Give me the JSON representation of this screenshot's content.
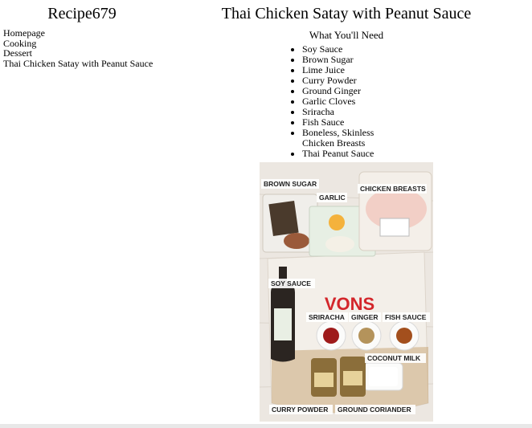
{
  "site": {
    "title": "Recipe679"
  },
  "nav": {
    "items": [
      {
        "label": "Homepage"
      },
      {
        "label": "Cooking"
      },
      {
        "label": "Dessert"
      },
      {
        "label": "Thai Chicken Satay with Peanut Sauce"
      }
    ]
  },
  "recipe": {
    "title": "Thai Chicken Satay with Peanut Sauce",
    "needs_heading": "What You'll Need",
    "ingredients": [
      "Soy Sauce",
      "Brown Sugar",
      "Lime Juice",
      "Curry Powder",
      "Ground Ginger",
      "Garlic Cloves",
      "Sriracha",
      "Fish Sauce",
      "Boneless, Skinless Chicken Breasts",
      "Thai Peanut Sauce"
    ]
  },
  "photo": {
    "labels": {
      "brown_sugar": "BROWN SUGAR",
      "garlic": "GARLIC",
      "chicken_breasts": "CHICKEN BREASTS",
      "soy_sauce": "SOY SAUCE",
      "sriracha": "SRIRACHA",
      "ginger": "GINGER",
      "fish_sauce": "FISH SAUCE",
      "coconut_milk": "COCONUT MILK",
      "curry_powder": "CURRY POWDER",
      "ground_coriander": "GROUND CORIANDER"
    },
    "bag_brand": "VONS",
    "colors": {
      "background": "#ece7e1",
      "bag": "#f3efe9",
      "bag_brand": "#d3262b",
      "chicken": "#f2cfc6",
      "bottle": "#2b2521"
    }
  }
}
